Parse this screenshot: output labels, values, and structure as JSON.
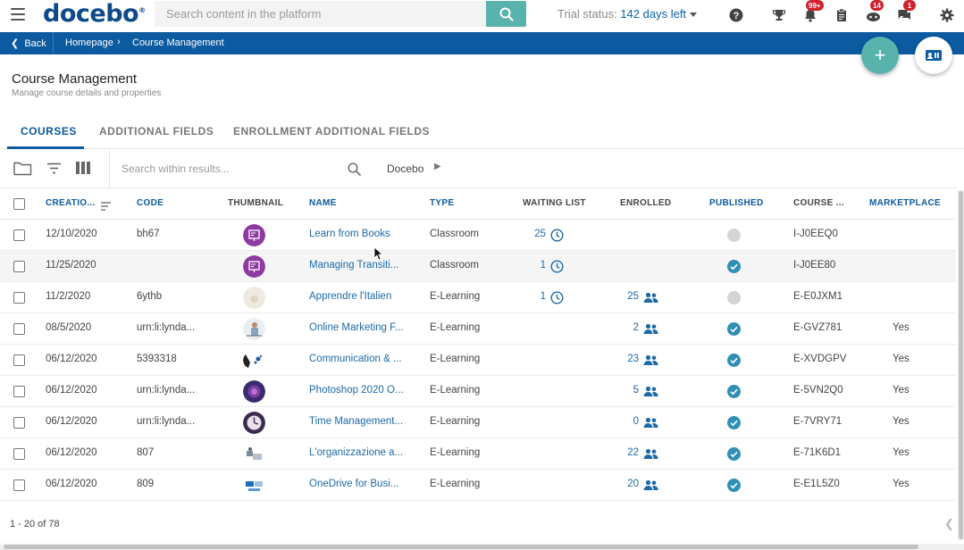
{
  "header": {
    "logo": "docebo",
    "logo_mark": "®",
    "search_placeholder": "Search content in the platform",
    "trial_label": "Trial status:",
    "trial_days": "142 days left",
    "icons": [
      {
        "name": "help-icon",
        "badge": ""
      },
      {
        "name": "trophy-icon",
        "badge": ""
      },
      {
        "name": "notifications-icon",
        "badge": "99+"
      },
      {
        "name": "clipboard-icon",
        "badge": ""
      },
      {
        "name": "coach-icon",
        "badge": "14"
      },
      {
        "name": "messages-icon",
        "badge": "1"
      },
      {
        "name": "settings-icon",
        "badge": ""
      }
    ]
  },
  "breadcrumb": {
    "back": "Back",
    "home": "Homepage",
    "current": "Course Management"
  },
  "page": {
    "title": "Course Management",
    "subtitle": "Manage course details and properties"
  },
  "tabs": [
    "COURSES",
    "ADDITIONAL FIELDS",
    "ENROLLMENT ADDITIONAL FIELDS"
  ],
  "toolbar": {
    "search_placeholder": "Search within results...",
    "scope": "Docebo"
  },
  "table": {
    "columns": {
      "creation": "CREATIO...",
      "code": "CODE",
      "thumbnail": "THUMBNAIL",
      "name": "NAME",
      "type": "TYPE",
      "waiting": "WAITING LIST",
      "enrolled": "ENROLLED",
      "published": "PUBLISHED",
      "course_id": "COURSE ...",
      "marketplace": "MARKETPLACE"
    },
    "rows": [
      {
        "date": "12/10/2020",
        "code": "bh67",
        "name": "Learn from Books",
        "type": "Classroom",
        "waiting": "25",
        "enrolled": "",
        "published": false,
        "course_id": "I-J0EEQ0",
        "marketplace": "",
        "thumb": "classroom"
      },
      {
        "date": "11/25/2020",
        "code": "",
        "name": "Managing Transiti...",
        "type": "Classroom",
        "waiting": "1",
        "enrolled": "",
        "published": true,
        "course_id": "I-J0EE80",
        "marketplace": "",
        "thumb": "classroom"
      },
      {
        "date": "11/2/2020",
        "code": "6ythb",
        "name": "Apprendre l'Italien",
        "type": "E-Learning",
        "waiting": "1",
        "enrolled": "25",
        "published": false,
        "course_id": "E-E0JXM1",
        "marketplace": "",
        "thumb": "light"
      },
      {
        "date": "08/5/2020",
        "code": "urn:li:lynda...",
        "name": "Online Marketing F...",
        "type": "E-Learning",
        "waiting": "",
        "enrolled": "2",
        "published": true,
        "course_id": "E-GVZ781",
        "marketplace": "Yes",
        "thumb": "person"
      },
      {
        "date": "06/12/2020",
        "code": "5393318",
        "name": "Communication & ...",
        "type": "E-Learning",
        "waiting": "",
        "enrolled": "23",
        "published": true,
        "course_id": "E-XVDGPV",
        "marketplace": "Yes",
        "thumb": "comm"
      },
      {
        "date": "06/12/2020",
        "code": "urn:li:lynda...",
        "name": "Photoshop 2020 O...",
        "type": "E-Learning",
        "waiting": "",
        "enrolled": "5",
        "published": true,
        "course_id": "E-5VN2Q0",
        "marketplace": "Yes",
        "thumb": "photoshop"
      },
      {
        "date": "06/12/2020",
        "code": "urn:li:lynda...",
        "name": "Time Management...",
        "type": "E-Learning",
        "waiting": "",
        "enrolled": "0",
        "published": true,
        "course_id": "E-7VRY71",
        "marketplace": "Yes",
        "thumb": "clock"
      },
      {
        "date": "06/12/2020",
        "code": "807",
        "name": "L'organizzazione a...",
        "type": "E-Learning",
        "waiting": "",
        "enrolled": "22",
        "published": true,
        "course_id": "E-71K6D1",
        "marketplace": "Yes",
        "thumb": "org"
      },
      {
        "date": "06/12/2020",
        "code": "809",
        "name": "OneDrive for Busi...",
        "type": "E-Learning",
        "waiting": "",
        "enrolled": "20",
        "published": true,
        "course_id": "E-E1L5Z0",
        "marketplace": "Yes",
        "thumb": "onedrive"
      }
    ]
  },
  "footer": {
    "range": "1 - 20 of 78"
  },
  "colors": {
    "brand": "#0c5aa0",
    "accent": "#58b3ad",
    "badge": "#d0202e"
  }
}
